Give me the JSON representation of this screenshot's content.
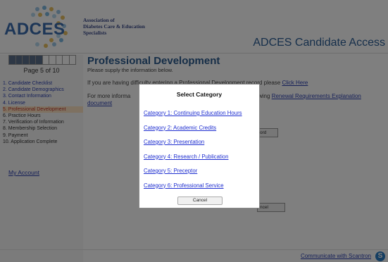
{
  "header": {
    "logo_text": "ADCES",
    "association_lines": [
      "Association of",
      "Diabetes Care & Education",
      "Specialists"
    ],
    "portal_title": "ADCES Candidate Access"
  },
  "sidebar": {
    "progress": {
      "current": 5,
      "total": 10
    },
    "page_label": "Page 5 of 10",
    "steps": [
      {
        "label": "1.  Candidate Checklist",
        "state": "link"
      },
      {
        "label": "2.  Candidate Demographics",
        "state": "link"
      },
      {
        "label": "3.  Contact Information",
        "state": "link"
      },
      {
        "label": "4.  License",
        "state": "link"
      },
      {
        "label": "5.  Professional Development",
        "state": "active"
      },
      {
        "label": "6.  Practice Hours",
        "state": "normal"
      },
      {
        "label": "7.  Verification of Information",
        "state": "normal"
      },
      {
        "label": "8.  Membership Selection",
        "state": "normal"
      },
      {
        "label": "9.  Payment",
        "state": "normal"
      },
      {
        "label": "10. Application Complete",
        "state": "normal"
      }
    ],
    "my_account": "My Account"
  },
  "main": {
    "title": "Professional Development",
    "subtitle": "Please supply the information below.",
    "trouble_text": "If you are having difficulty entering a Professional Development record please ",
    "trouble_link": "Click Here",
    "more_info_text": "For more informa",
    "more_info_link": "document",
    "renewal_text": "wing ",
    "renewal_link": "Renewal Requirements Explanation",
    "record_button": "ord",
    "cancel_button": "ncel"
  },
  "footer": {
    "communicate_link": "Communicate with Scantron",
    "icon_letter": "S"
  },
  "modal": {
    "title": "Select Category",
    "categories": [
      "Category 1: Continuing Education Hours",
      "Category 2: Academic Credits",
      "Category 3: Presentation",
      "Category 4: Research / Publication",
      "Category 5: Preceptor",
      "Category 6: Professional Service"
    ],
    "cancel_label": "Cancel"
  },
  "colors": {
    "brand_blue": "#2a5a8e",
    "link_blue": "#1f2fd0",
    "active_step_bg": "#fde2c2",
    "overlay": "rgba(0,0,0,0.5)"
  }
}
